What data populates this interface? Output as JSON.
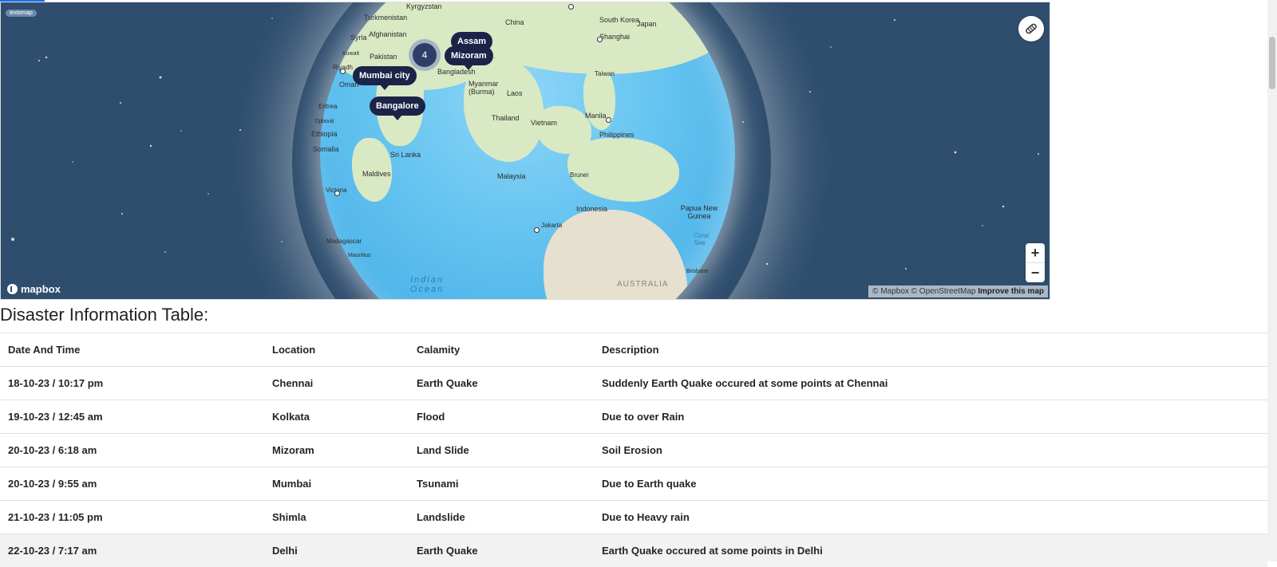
{
  "map": {
    "logo_badge": "textomap",
    "mapbox_label": "mapbox",
    "attribution_text": "© Mapbox © OpenStreetMap",
    "improve_label": "Improve this map",
    "zoom_in": "+",
    "zoom_out": "−",
    "markers": [
      {
        "label": "Assam"
      },
      {
        "label": "Mizoram"
      },
      {
        "label": "Mumbai city"
      },
      {
        "label": "Bangalore"
      }
    ],
    "cluster_count": "4",
    "place_labels": [
      "Kyrgyzstan",
      "Turkmenistan",
      "China",
      "South Korea",
      "Japan",
      "Syria",
      "Afghanistan",
      "Shanghai",
      "Kuwait",
      "Pakistan",
      "Riyadh",
      "Oman",
      "Bangladesh",
      "Myanmar (Burma)",
      "Laos",
      "Taiwan",
      "Eritrea",
      "Thailand",
      "Vietnam",
      "Manila",
      "Djibouti",
      "Ethiopia",
      "Philippines",
      "Somalia",
      "Sri Lanka",
      "Maldives",
      "Malaysia",
      "Brunei",
      "Victoria",
      "Indonesia",
      "Papua New Guinea",
      "Jakarta",
      "Madagascar",
      "Mauritius",
      "Coral Sea",
      "Brisbane",
      "AUSTRALIA",
      "Indian Ocean"
    ]
  },
  "table": {
    "title": "Disaster Information Table:",
    "headers": [
      "Date And Time",
      "Location",
      "Calamity",
      "Description"
    ],
    "rows": [
      [
        "18-10-23 / 10:17 pm",
        "Chennai",
        "Earth Quake",
        "Suddenly Earth Quake occured at some points at Chennai"
      ],
      [
        "19-10-23 / 12:45 am",
        "Kolkata",
        "Flood",
        "Due to over Rain"
      ],
      [
        "20-10-23 / 6:18 am",
        "Mizoram",
        "Land Slide",
        "Soil Erosion"
      ],
      [
        "20-10-23 / 9:55 am",
        "Mumbai",
        "Tsunami",
        "Due to Earth quake"
      ],
      [
        "21-10-23 / 11:05 pm",
        "Shimla",
        "Landslide",
        "Due to Heavy rain"
      ],
      [
        "22-10-23 / 7:17 am",
        "Delhi",
        "Earth Quake",
        "Earth Quake occured at some points in Delhi"
      ]
    ]
  }
}
